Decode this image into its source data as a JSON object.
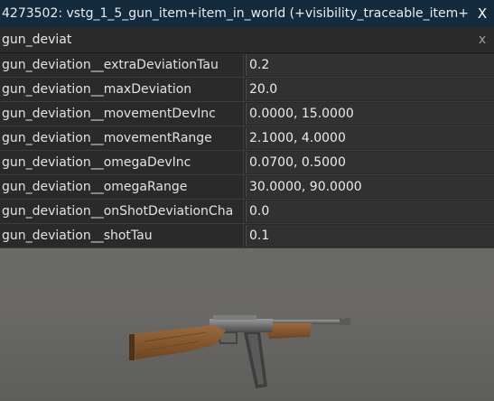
{
  "window": {
    "title": "4273502: vstg_1_5_gun_item+item_in_world (+visibility_traceable_item+",
    "close_label": "X"
  },
  "filter": {
    "value": "gun_deviat",
    "clear_label": "x"
  },
  "properties": [
    {
      "key": "gun_deviation__extraDeviationTau",
      "value": "0.2"
    },
    {
      "key": "gun_deviation__maxDeviation",
      "value": "20.0"
    },
    {
      "key": "gun_deviation__movementDevInc",
      "value": "0.0000, 15.0000"
    },
    {
      "key": "gun_deviation__movementRange",
      "value": "2.1000, 4.0000"
    },
    {
      "key": "gun_deviation__omegaDevInc",
      "value": "0.0700, 0.5000"
    },
    {
      "key": "gun_deviation__omegaRange",
      "value": "30.0000, 90.0000"
    },
    {
      "key": "gun_deviation__onShotDeviationCha",
      "value": "0.0"
    },
    {
      "key": "gun_deviation__shotTau",
      "value": "0.1"
    }
  ],
  "colors": {
    "titlebar": "#142a3d",
    "panel": "#2a2a2a",
    "text": "#e2e2e2"
  }
}
